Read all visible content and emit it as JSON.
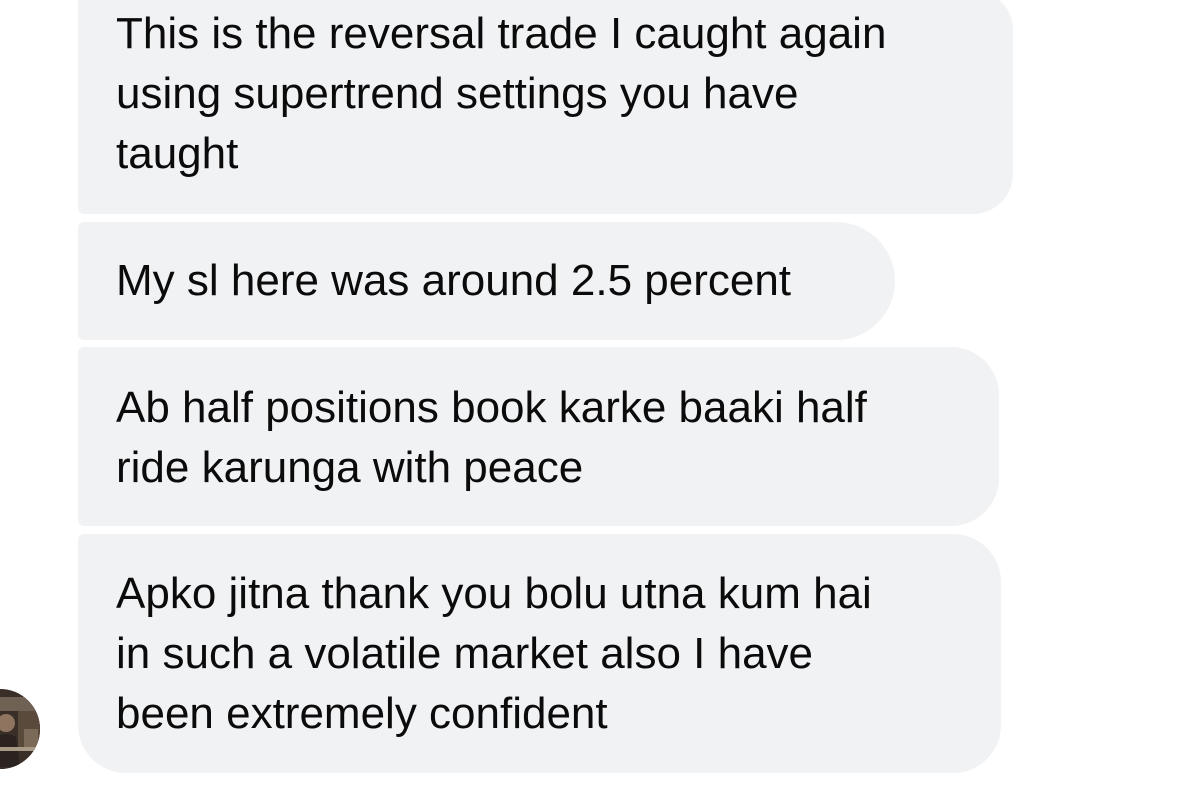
{
  "messages": [
    {
      "lines": [
        "This is the reversal trade I caught again",
        "using supertrend settings you have",
        "taught"
      ]
    },
    {
      "lines": [
        "My sl here was around 2.5 percent"
      ]
    },
    {
      "lines": [
        "Ab half positions book karke baaki half",
        "ride karunga with peace"
      ]
    },
    {
      "lines": [
        "Apko jitna thank you bolu utna kum hai",
        "in such a volatile market also I have",
        "been extremely confident"
      ]
    }
  ],
  "colors": {
    "bubble_background": "#f1f2f4",
    "text": "#0b0b0b",
    "background": "#ffffff"
  },
  "avatar": {
    "icon": "sender-avatar"
  }
}
